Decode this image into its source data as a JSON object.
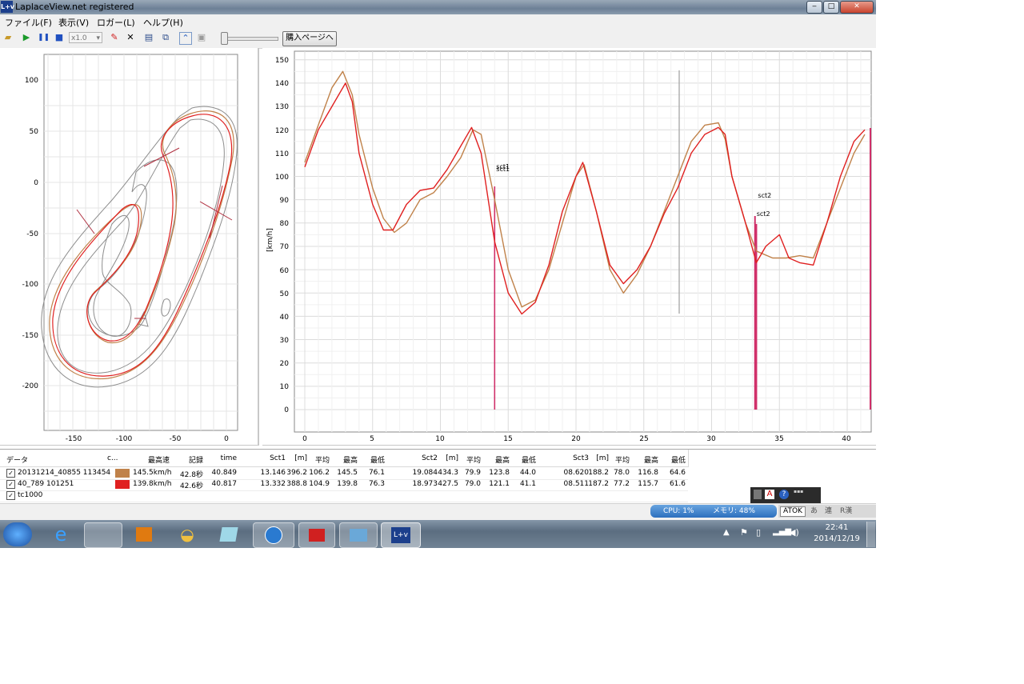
{
  "window": {
    "title": "LaplaceView.net registered",
    "icon_text": "L+v"
  },
  "menu": [
    "ファイル(F)",
    "表示(V)",
    "ロガー(L)",
    "ヘルプ(H)"
  ],
  "toolbar": {
    "zoom_value": "x1.0",
    "buy_label": "購入ページへ"
  },
  "colors": {
    "trace_1": "#c0824a",
    "trace_2": "#e02020",
    "marker": "#d0306a",
    "grid": "#e4e4e4"
  },
  "map": {
    "y_ticks": [
      "100",
      "50",
      "0",
      "-50",
      "-100",
      "-150",
      "-200"
    ],
    "x_ticks": [
      "-150",
      "-100",
      "-50",
      "0"
    ]
  },
  "speed_chart": {
    "ylabel": "[km/h]",
    "y_ticks": [
      "150",
      "140",
      "130",
      "120",
      "110",
      "100",
      "90",
      "80",
      "70",
      "60",
      "50",
      "40",
      "30",
      "20",
      "10",
      "0"
    ],
    "x_ticks": [
      "0",
      "5",
      "10",
      "15",
      "20",
      "25",
      "30",
      "35",
      "40"
    ],
    "markers": [
      {
        "label": "sct1",
        "x": 14.0
      },
      {
        "label": "sct1",
        "x": 14.0
      },
      {
        "label": "sct2",
        "x": 33.3
      },
      {
        "label": "sct2",
        "x": 33.2
      }
    ]
  },
  "chart_data": {
    "type": "line",
    "xlabel": "",
    "ylabel": "[km/h]",
    "xlim": [
      -0.7,
      41.5
    ],
    "ylim": [
      -5,
      152
    ],
    "grid": true,
    "series": [
      {
        "name": "20131214_40855 113454",
        "color": "#c0824a",
        "x": [
          0,
          1,
          2,
          2.8,
          3.5,
          4,
          5,
          5.8,
          6.6,
          7.5,
          8.5,
          9.5,
          10.5,
          11.5,
          12.4,
          13,
          14,
          15,
          16,
          17,
          18,
          19,
          20,
          20.6,
          21.5,
          22.5,
          23.5,
          24.5,
          25.5,
          26.5,
          27.5,
          28.5,
          29.5,
          30.5,
          31,
          31.5,
          32.5,
          33.3,
          34.5,
          35.5,
          36.5,
          37.5,
          38.5,
          39.5,
          40.5,
          41.3
        ],
        "y": [
          106,
          122,
          138,
          145,
          135,
          118,
          95,
          82,
          76,
          80,
          90,
          93,
          100,
          108,
          120,
          118,
          90,
          60,
          44,
          47,
          60,
          80,
          100,
          105,
          85,
          60,
          50,
          58,
          70,
          85,
          100,
          115,
          122,
          123,
          116,
          100,
          80,
          68,
          65,
          65,
          66,
          65,
          80,
          95,
          110,
          118
        ]
      },
      {
        "name": "40_789 101251",
        "color": "#e02020",
        "x": [
          0,
          1,
          2,
          3,
          3.5,
          4,
          5,
          5.8,
          6.5,
          7.5,
          8.5,
          9.5,
          10.5,
          11.5,
          12.3,
          13,
          14,
          15,
          16,
          17,
          18,
          19,
          20,
          20.5,
          21.5,
          22.5,
          23.5,
          24.5,
          25.5,
          26.5,
          27.5,
          28.5,
          29.5,
          30.5,
          31,
          31.5,
          32.5,
          33.3,
          34,
          35,
          35.7,
          36.5,
          37.5,
          38.5,
          39.5,
          40.5,
          41.3
        ],
        "y": [
          104,
          120,
          130,
          140,
          132,
          110,
          88,
          77,
          77,
          88,
          94,
          95,
          103,
          113,
          121,
          110,
          72,
          50,
          41,
          46,
          62,
          85,
          100,
          106,
          85,
          62,
          54,
          60,
          70,
          84,
          95,
          110,
          118,
          121,
          118,
          100,
          80,
          63,
          70,
          75,
          65,
          63,
          62,
          80,
          100,
          115,
          120
        ]
      }
    ],
    "table": {
      "headers": [
        "データ",
        "c...",
        "最高速",
        "記録",
        "time",
        "Sct1",
        "[m]",
        "平均",
        "最高",
        "最低",
        "Sct2",
        "[m]",
        "平均",
        "最高",
        "最低",
        "Sct3",
        "[m]",
        "平均",
        "最高",
        "最低"
      ],
      "rows": [
        {
          "checked": true,
          "color": "#c0824a",
          "cells": [
            "20131214_40855 113454",
            "",
            "145.5km/h",
            "42.8秒",
            "40.849",
            "13.146",
            "396.2",
            "106.2",
            "145.5",
            "76.1",
            "19.084",
            "434.3",
            "79.9",
            "123.8",
            "44.0",
            "08.620",
            "188.2",
            "78.0",
            "116.8",
            "64.6"
          ]
        },
        {
          "checked": true,
          "color": "#e02020",
          "cells": [
            "40_789 101251",
            "",
            "139.8km/h",
            "42.6秒",
            "40.817",
            "13.332",
            "388.8",
            "104.9",
            "139.8",
            "76.3",
            "18.973",
            "427.5",
            "79.0",
            "121.1",
            "41.1",
            "08.511",
            "187.2",
            "77.2",
            "115.7",
            "61.6"
          ]
        },
        {
          "checked": true,
          "color": "",
          "cells": [
            "tc1000"
          ]
        }
      ]
    }
  },
  "status": {
    "cpu": "CPU: 1%",
    "memory": "メモリ: 48%",
    "ime": "ATOK",
    "ime_modes": [
      "あ",
      "連",
      "R漢"
    ]
  },
  "taskbar": {
    "time": "22:41",
    "date": "2014/12/19"
  }
}
